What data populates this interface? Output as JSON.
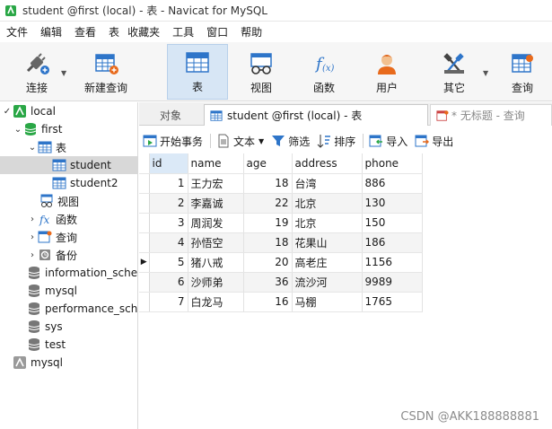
{
  "window": {
    "title": "student @first (local) - 表 - Navicat for MySQL"
  },
  "menu": [
    "文件",
    "编辑",
    "查看",
    "表",
    "收藏夹",
    "工具",
    "窗口",
    "帮助"
  ],
  "toolbar": {
    "connect": "连接",
    "new_query": "新建查询",
    "table": "表",
    "view": "视图",
    "function": "函数",
    "user": "用户",
    "other": "其它",
    "query": "查询"
  },
  "tree": {
    "local": "local",
    "first": "first",
    "tables": "表",
    "student": "student",
    "student2": "student2",
    "views": "视图",
    "functions": "函数",
    "queries": "查询",
    "backups": "备份",
    "information_schema": "information_sche",
    "mysql": "mysql",
    "performance_schema": "performance_sch",
    "sys": "sys",
    "test": "test",
    "mysql_conn": "mysql"
  },
  "tabs": {
    "objects": "对象",
    "active": "student @first (local) - 表",
    "untitled": "* 无标题 - 查询"
  },
  "subtoolbar": {
    "begin_transaction": "开始事务",
    "text": "文本",
    "filter": "筛选",
    "sort": "排序",
    "import": "导入",
    "export": "导出"
  },
  "table": {
    "columns": [
      "id",
      "name",
      "age",
      "address",
      "phone"
    ],
    "rows": [
      {
        "id": "1",
        "name": "王力宏",
        "age": "18",
        "address": "台湾",
        "phone": "886"
      },
      {
        "id": "2",
        "name": "李嘉诚",
        "age": "22",
        "address": "北京",
        "phone": "130"
      },
      {
        "id": "3",
        "name": "周润发",
        "age": "19",
        "address": "北京",
        "phone": "150"
      },
      {
        "id": "4",
        "name": "孙悟空",
        "age": "18",
        "address": "花果山",
        "phone": "186"
      },
      {
        "id": "5",
        "name": "猪八戒",
        "age": "20",
        "address": "高老庄",
        "phone": "1156"
      },
      {
        "id": "6",
        "name": "沙师弟",
        "age": "36",
        "address": "流沙河",
        "phone": "9989"
      },
      {
        "id": "7",
        "name": "白龙马",
        "age": "16",
        "address": "马棚",
        "phone": "1765"
      }
    ]
  },
  "watermark": "CSDN @AKK188888881",
  "colors": {
    "accent": "#2e75c9",
    "selected_header": "#dbe9f7",
    "tree_selected": "#d8d8d8"
  }
}
